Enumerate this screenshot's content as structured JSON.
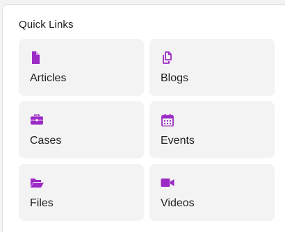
{
  "quick_links": {
    "title": "Quick Links",
    "accent_color": "#9b2bc4",
    "items": [
      {
        "label": "Articles",
        "icon": "document-icon"
      },
      {
        "label": "Blogs",
        "icon": "copy-icon"
      },
      {
        "label": "Cases",
        "icon": "briefcase-icon"
      },
      {
        "label": "Events",
        "icon": "calendar-icon"
      },
      {
        "label": "Files",
        "icon": "folder-open-icon"
      },
      {
        "label": "Videos",
        "icon": "video-camera-icon"
      }
    ]
  }
}
